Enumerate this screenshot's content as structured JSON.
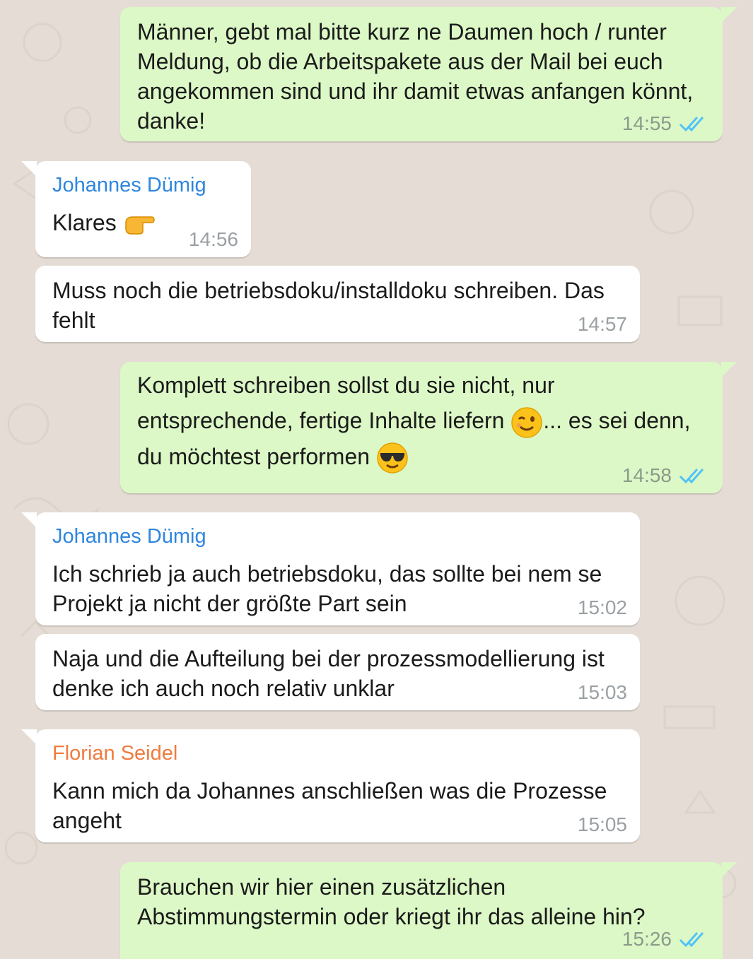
{
  "colors": {
    "outgoing_bubble": "#dcf8c6",
    "incoming_bubble": "#ffffff",
    "background": "#e5ddd5",
    "read_ticks": "#4fc3f7",
    "sender_johannes": "#2e86de",
    "sender_florian": "#f07b3f"
  },
  "messages": [
    {
      "direction": "outgoing",
      "text": "Männer, gebt mal bitte kurz ne Daumen hoch / runter Meldung, ob die Arbeitspakete aus der Mail bei euch angekommen sind und ihr damit etwas anfangen könnt, danke!",
      "time": "14:55",
      "status": "read"
    },
    {
      "direction": "incoming",
      "sender": "Johannes Dümig",
      "text": "Klares",
      "emoji": "backhand-index-pointing-right",
      "time": "14:56"
    },
    {
      "direction": "incoming",
      "text": "Muss noch die betriebsdoku/installdoku schreiben. Das fehlt",
      "time": "14:57"
    },
    {
      "direction": "outgoing",
      "text_part1": "Komplett schreiben sollst du sie nicht, nur entsprechende, fertige Inhalte liefern ",
      "emoji1": "winking-face",
      "text_part2": "... es sei denn, du möchtest performen ",
      "emoji2": "smiling-face-with-sunglasses",
      "time": "14:58",
      "status": "read"
    },
    {
      "direction": "incoming",
      "sender": "Johannes Dümig",
      "text": "Ich schrieb ja auch betriebsdoku, das sollte bei nem se Projekt ja nicht der größte Part sein",
      "time": "15:02"
    },
    {
      "direction": "incoming",
      "text": "Naja und die Aufteilung bei der prozessmodellierung ist denke ich auch noch relativ unklar",
      "time": "15:03"
    },
    {
      "direction": "incoming",
      "sender": "Florian Seidel",
      "text": "Kann mich da Johannes anschließen was die Prozesse angeht",
      "time": "15:05"
    },
    {
      "direction": "outgoing",
      "text": "Brauchen wir hier einen zusätzlichen Abstimmungstermin oder kriegt ihr das alleine hin?",
      "time": "15:26",
      "status": "read"
    }
  ]
}
